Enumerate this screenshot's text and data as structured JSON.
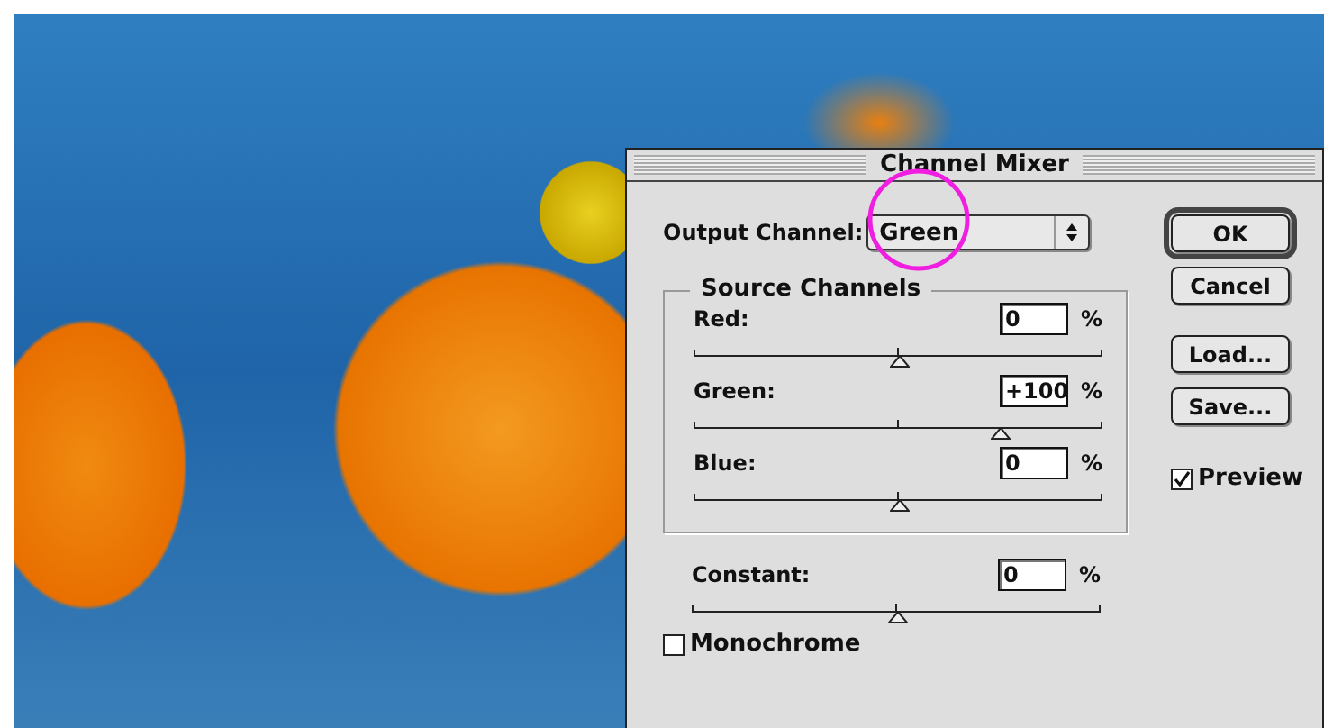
{
  "dialog": {
    "title": "Channel Mixer",
    "output_channel": {
      "label": "Output Channel:",
      "value": "Green"
    },
    "source_channels": {
      "title": "Source Channels",
      "sliders": [
        {
          "label": "Red:",
          "value": "0",
          "unit": "%",
          "level": 0.5
        },
        {
          "label": "Green:",
          "value": "+100",
          "unit": "%",
          "level": 0.75
        },
        {
          "label": "Blue:",
          "value": "0",
          "unit": "%",
          "level": 0.5
        }
      ]
    },
    "constant": {
      "label": "Constant:",
      "value": "0",
      "unit": "%",
      "level": 0.5
    },
    "monochrome": {
      "label": "Monochrome",
      "checked": false
    },
    "buttons": [
      {
        "label": "OK",
        "default": true
      },
      {
        "label": "Cancel",
        "default": false
      },
      {
        "label": "Load...",
        "default": false
      },
      {
        "label": "Save...",
        "default": false
      }
    ],
    "preview": {
      "label": "Preview",
      "checked": true
    }
  }
}
